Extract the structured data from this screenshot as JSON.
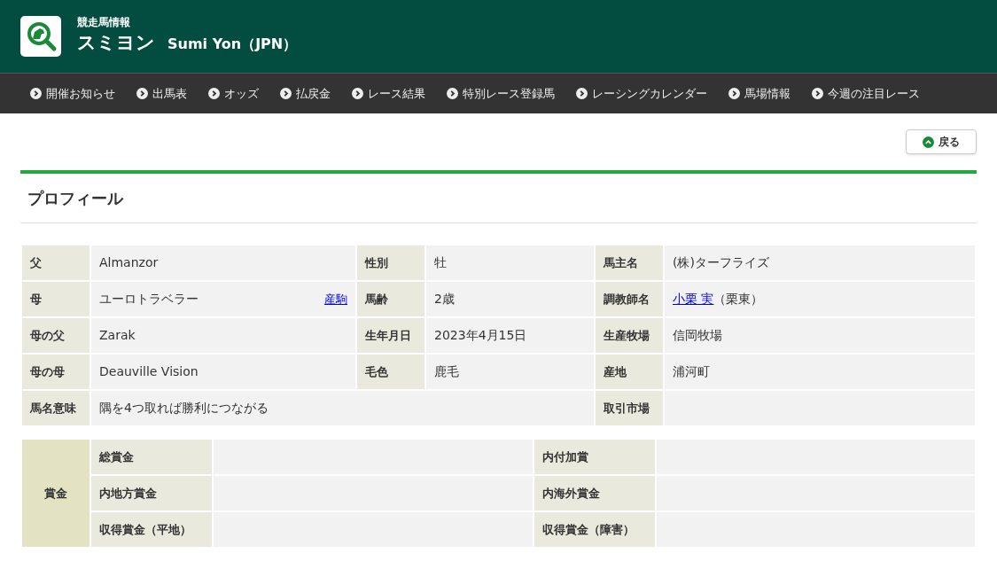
{
  "header": {
    "category": "競走馬情報",
    "name_ja": "スミヨン",
    "name_en": "Sumi Yon（JPN）"
  },
  "nav": [
    "開催お知らせ",
    "出馬表",
    "オッズ",
    "払戻金",
    "レース結果",
    "特別レース登録馬",
    "レーシングカレンダー",
    "馬場情報",
    "今週の注目レース"
  ],
  "back_button": "戻る",
  "section_title": "プロフィール",
  "profile": [
    [
      {
        "label": "父",
        "value": "Almanzor"
      },
      {
        "label": "性別",
        "value": "牡"
      },
      {
        "label": "馬主名",
        "value": "(株)ターフライズ"
      }
    ],
    [
      {
        "label": "母",
        "value": "ユーロトラベラー",
        "side_link": "産駒"
      },
      {
        "label": "馬齢",
        "value": "2歳"
      },
      {
        "label": "調教師名",
        "link": "小栗 実",
        "value": "（栗東）"
      }
    ],
    [
      {
        "label": "母の父",
        "value": "Zarak"
      },
      {
        "label": "生年月日",
        "value": "2023年4月15日"
      },
      {
        "label": "生産牧場",
        "value": "信岡牧場"
      }
    ],
    [
      {
        "label": "母の母",
        "value": "Deauville Vision"
      },
      {
        "label": "毛色",
        "value": "鹿毛"
      },
      {
        "label": "産地",
        "value": "浦河町"
      }
    ],
    [
      {
        "label": "馬名意味",
        "value": "隅を4つ取れば勝利につながる",
        "wide": true
      },
      {
        "label": "取引市場"
      }
    ]
  ],
  "prize": {
    "label": "賞金",
    "rows": [
      [
        {
          "label": "総賞金"
        },
        {
          "label": "内付加賞"
        }
      ],
      [
        {
          "label": "内地方賞金"
        },
        {
          "label": "内海外賞金"
        }
      ],
      [
        {
          "label": "収得賞金（平地）"
        },
        {
          "label": "収得賞金（障害）"
        }
      ]
    ]
  }
}
